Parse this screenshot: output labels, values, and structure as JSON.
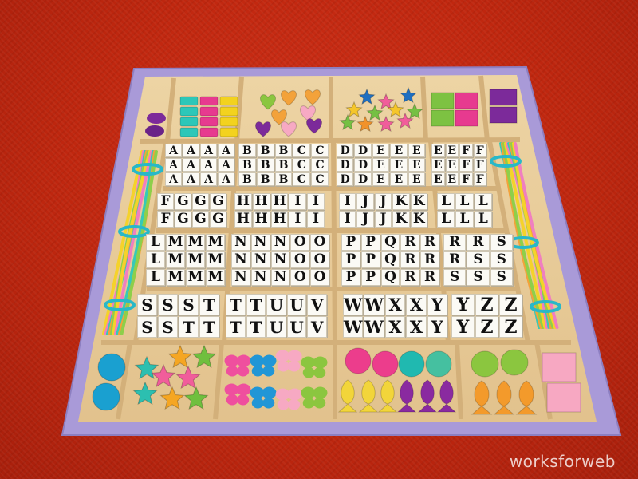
{
  "scene": {
    "subject": "wooden bead and letter-tile craft box",
    "watermark": "worksforweb",
    "colors": {
      "carpet": "#c0270f",
      "frame": "#a99ad8",
      "wood": "#e9cf9e",
      "divider": "#d9b986",
      "tile": "#fbfaf5"
    }
  },
  "letter_compartments": [
    {
      "rows": [
        [
          "A",
          "A",
          "A",
          "A"
        ],
        [
          "A",
          "A",
          "A",
          "A"
        ],
        [
          "A",
          "A",
          "A",
          "A"
        ]
      ]
    },
    {
      "rows": [
        [
          "B",
          "B",
          "B",
          "C",
          "C"
        ],
        [
          "B",
          "B",
          "B",
          "C",
          "C"
        ],
        [
          "B",
          "B",
          "B",
          "C",
          "C"
        ]
      ]
    },
    {
      "rows": [
        [
          "D",
          "D",
          "E",
          "E",
          "E"
        ],
        [
          "D",
          "D",
          "E",
          "E",
          "E"
        ],
        [
          "D",
          "D",
          "E",
          "E",
          "E"
        ]
      ]
    },
    {
      "rows": [
        [
          "E",
          "E",
          "F",
          "F"
        ],
        [
          "E",
          "E",
          "F",
          "F"
        ],
        [
          "E",
          "E",
          "F",
          "F"
        ]
      ]
    },
    {
      "rows": [
        [
          "F",
          "G",
          "G",
          "G"
        ],
        [
          "F",
          "G",
          "G",
          "G"
        ]
      ]
    },
    {
      "rows": [
        [
          "H",
          "H",
          "H",
          "I",
          "I"
        ],
        [
          "H",
          "H",
          "H",
          "I",
          "I"
        ]
      ]
    },
    {
      "rows": [
        [
          "I",
          "J",
          "J",
          "K",
          "K"
        ],
        [
          "I",
          "J",
          "J",
          "K",
          "K"
        ]
      ]
    },
    {
      "rows": [
        [
          "L",
          "L",
          "L"
        ],
        [
          "L",
          "L",
          "L"
        ]
      ]
    },
    {
      "rows": [
        [
          "L",
          "M",
          "M",
          "M"
        ],
        [
          "L",
          "M",
          "M",
          "M"
        ],
        [
          "L",
          "M",
          "M",
          "M"
        ]
      ]
    },
    {
      "rows": [
        [
          "N",
          "N",
          "N",
          "O",
          "O"
        ],
        [
          "N",
          "N",
          "N",
          "O",
          "O"
        ],
        [
          "N",
          "N",
          "N",
          "O",
          "O"
        ]
      ]
    },
    {
      "rows": [
        [
          "P",
          "P",
          "Q",
          "R",
          "R"
        ],
        [
          "P",
          "P",
          "Q",
          "R",
          "R"
        ],
        [
          "P",
          "P",
          "Q",
          "R",
          "R"
        ]
      ]
    },
    {
      "rows": [
        [
          "R",
          "R",
          "S"
        ],
        [
          "R",
          "S",
          "S"
        ],
        [
          "S",
          "S",
          "S"
        ]
      ]
    },
    {
      "rows": [
        [
          "S",
          "S",
          "S",
          "T"
        ],
        [
          "S",
          "S",
          "T",
          "T"
        ]
      ]
    },
    {
      "rows": [
        [
          "T",
          "T",
          "U",
          "U",
          "V"
        ],
        [
          "T",
          "T",
          "U",
          "U",
          "V"
        ]
      ]
    },
    {
      "rows": [
        [
          "W",
          "W",
          "X",
          "X",
          "Y"
        ],
        [
          "W",
          "W",
          "X",
          "X",
          "Y"
        ]
      ]
    },
    {
      "rows": [
        [
          "Y",
          "Z",
          "Z"
        ],
        [
          "Y",
          "Z",
          "Z"
        ]
      ]
    }
  ],
  "bead_compartments": [
    {
      "shape": "round",
      "colors": [
        "#7c2a9a",
        "#6a2388"
      ]
    },
    {
      "shape": "square",
      "colors": [
        "#2dc7b8",
        "#e73a8f",
        "#f3d21e"
      ]
    },
    {
      "shape": "heart",
      "colors": [
        "#8bc63f",
        "#f3a23a",
        "#f7a9c3",
        "#7c2a9a"
      ]
    },
    {
      "shape": "star",
      "colors": [
        "#1f6fc0",
        "#f15d9b",
        "#f5c62a",
        "#75c043",
        "#f2922a"
      ]
    },
    {
      "shape": "cube",
      "colors": [
        "#7dc242",
        "#e73a8f"
      ]
    },
    {
      "shape": "cube",
      "colors": [
        "#7c2a9a"
      ]
    },
    {
      "shape": "oval",
      "colors": [
        "#1aa0d0"
      ]
    },
    {
      "shape": "star",
      "colors": [
        "#2cbfb0",
        "#f15d9b",
        "#f5a623",
        "#6fbf3e",
        "#e0303a"
      ]
    },
    {
      "shape": "butterfly",
      "colors": [
        "#ef4f9e",
        "#2196d6",
        "#f7a9c3",
        "#8bc63f"
      ]
    },
    {
      "shape": "fish",
      "colors": [
        "#ec3d8c",
        "#20b9b0",
        "#f2d53a",
        "#8a2aa0",
        "#45c0a0"
      ]
    },
    {
      "shape": "fish",
      "colors": [
        "#8bc63f",
        "#f39a2b"
      ]
    },
    {
      "shape": "cube",
      "colors": [
        "#f7a8c2"
      ]
    }
  ],
  "laces": {
    "colors": [
      "#f5d22a",
      "#f07fc0",
      "#36c9b8",
      "#f3a23a",
      "#8ecf4a"
    ]
  }
}
